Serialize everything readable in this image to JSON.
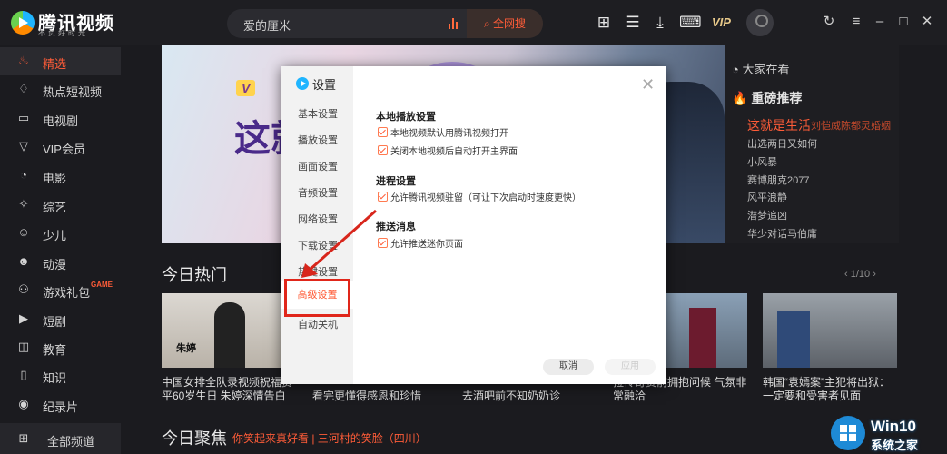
{
  "app": {
    "title": "腾讯视频",
    "subtitle": "不负好时光"
  },
  "search": {
    "value": "爱的厘米",
    "button": "全网搜"
  },
  "topbar": {
    "vip_label": "VIP"
  },
  "sidebar": {
    "items": [
      {
        "label": "精选",
        "icon": "flame-icon",
        "active": true
      },
      {
        "label": "热点短视频",
        "icon": "hot-video-icon"
      },
      {
        "label": "电视剧",
        "icon": "tv-icon"
      },
      {
        "label": "VIP会员",
        "icon": "vip-icon"
      },
      {
        "label": "电影",
        "icon": "film-icon"
      },
      {
        "label": "综艺",
        "icon": "variety-icon"
      },
      {
        "label": "少儿",
        "icon": "kids-icon"
      },
      {
        "label": "动漫",
        "icon": "anime-icon"
      },
      {
        "label": "游戏礼包",
        "icon": "gamepad-icon",
        "badge": "GAME"
      },
      {
        "label": "短剧",
        "icon": "play-icon"
      },
      {
        "label": "教育",
        "icon": "education-icon"
      },
      {
        "label": "知识",
        "icon": "book-icon"
      },
      {
        "label": "纪录片",
        "icon": "documentary-icon"
      }
    ],
    "all_channels": "全部频道"
  },
  "right_panel": {
    "header": "大家在看",
    "hot_label": "重磅推荐",
    "hot_title": "这就是生活",
    "hot_sub": "刘恺威陈都灵婚姻",
    "items": [
      "出选两日又如何",
      "小风暴",
      "赛博朋克2077",
      "风平浪静",
      "潜梦追凶",
      "华少对话马伯庸"
    ]
  },
  "sections": {
    "hot_today": "今日热门",
    "pager": "1/10",
    "focus_today": "今日聚焦",
    "focus_tags": "你笑起来真好看 | 三河村的笑脸（四川）"
  },
  "cards": [
    {
      "caption": "中国女排全队录视频祝福贾平60岁生日 朱婷深情告白"
    },
    {
      "caption": "看完更懂得感恩和珍惜"
    },
    {
      "caption": "去酒吧前不知奶奶诊"
    },
    {
      "caption": "拉传奇赛前拥抱问候 气氛非常融洽"
    },
    {
      "caption": "韩国“袁嫣案”主犯将出狱：一定要和受害者见面"
    }
  ],
  "dialog": {
    "title": "设置",
    "nav": [
      "基本设置",
      "播放设置",
      "画面设置",
      "音频设置",
      "网络设置",
      "下载设置",
      "热键设置",
      "高级设置",
      "自动关机"
    ],
    "groups": [
      {
        "title": "本地播放设置",
        "options": [
          "本地视频默认用腾讯视频打开",
          "关闭本地视频后自动打开主界面"
        ]
      },
      {
        "title": "进程设置",
        "options": [
          "允许腾讯视频驻留（可让下次启动时速度更快）"
        ]
      },
      {
        "title": "推送消息",
        "options": [
          "允许推送迷你页面"
        ]
      }
    ],
    "cancel": "取消",
    "apply": "应用"
  },
  "thumb_texts": {
    "card1_name": "朱婷"
  },
  "watermark": {
    "brand": "Win10",
    "sub": "系统之家"
  }
}
